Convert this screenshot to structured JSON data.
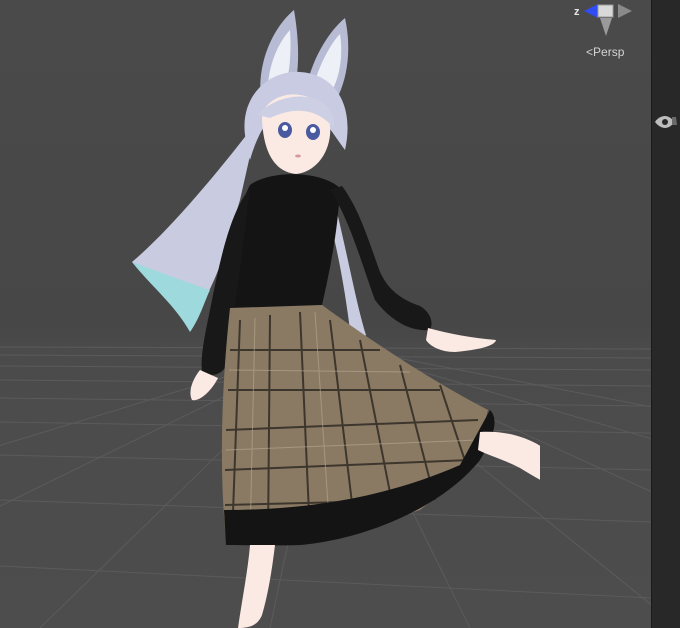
{
  "scene": {
    "gizmo": {
      "axis_label": "z"
    },
    "projection_label": "Persp",
    "projection_prefix": "<"
  },
  "side_panel": {
    "visibility_icon": "eye-icon",
    "picking_icon": "hand-icon"
  },
  "colors": {
    "background": "#474747",
    "grid_line": "#5a5a5a",
    "panel": "#282828",
    "gizmo_z_axis": "#2f4df0",
    "gizmo_cube": "#d9d9d9"
  }
}
